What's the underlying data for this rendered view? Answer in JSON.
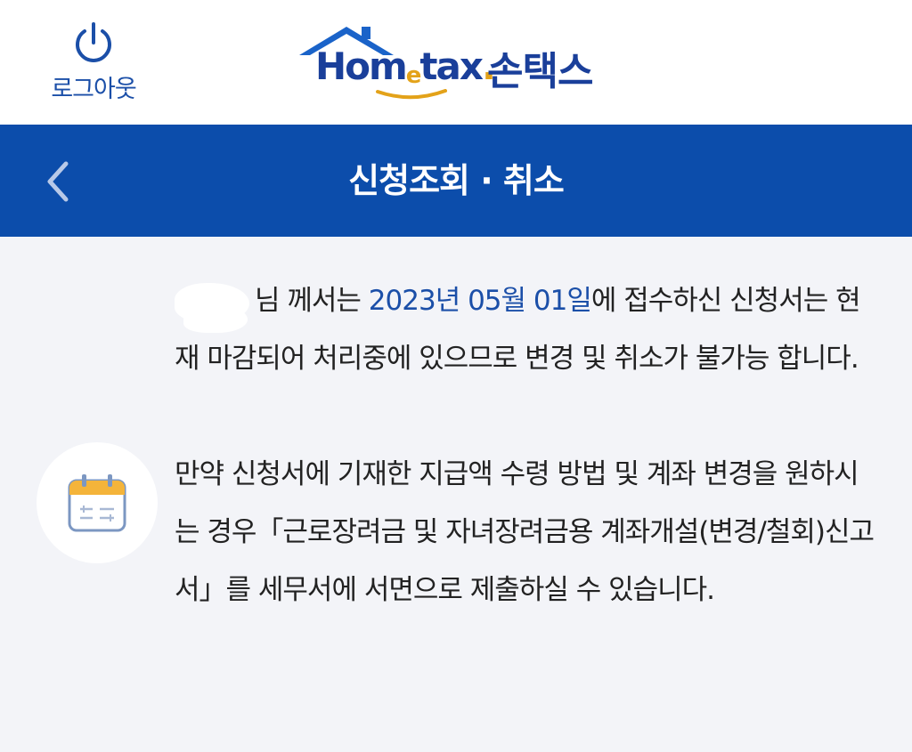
{
  "header": {
    "logout_label": "로그아웃",
    "logo_en_prefix": "Hom",
    "logo_en_e": "e",
    "logo_en_suffix": "tax",
    "logo_en_dot": ".",
    "logo_ko": "손택스"
  },
  "title_bar": {
    "title": "신청조회 · 취소"
  },
  "message": {
    "p1_suffix": "님 께서는 ",
    "p1_date": "2023년 05월 01일",
    "p1_rest": "에 접수하신 신청서는 현재 마감되어 처리중에 있으므로 변경 및 취소가 불가능 합니다.",
    "p2": "만약 신청서에 기재한 지급액 수령 방법 및 계좌 변경을 원하시는 경우「근로장려금 및 자녀장려금용 계좌개설(변경/철회)신고서」를 세무서에 서면으로 제출하실 수 있습니다."
  },
  "colors": {
    "brand_blue": "#0c4dab",
    "logo_blue": "#1a3f9a",
    "accent_gold": "#e3a219",
    "background": "#f3f4f8"
  },
  "icons": {
    "logout": "power-icon",
    "back": "chevron-left-icon",
    "calendar": "calendar-icon"
  }
}
